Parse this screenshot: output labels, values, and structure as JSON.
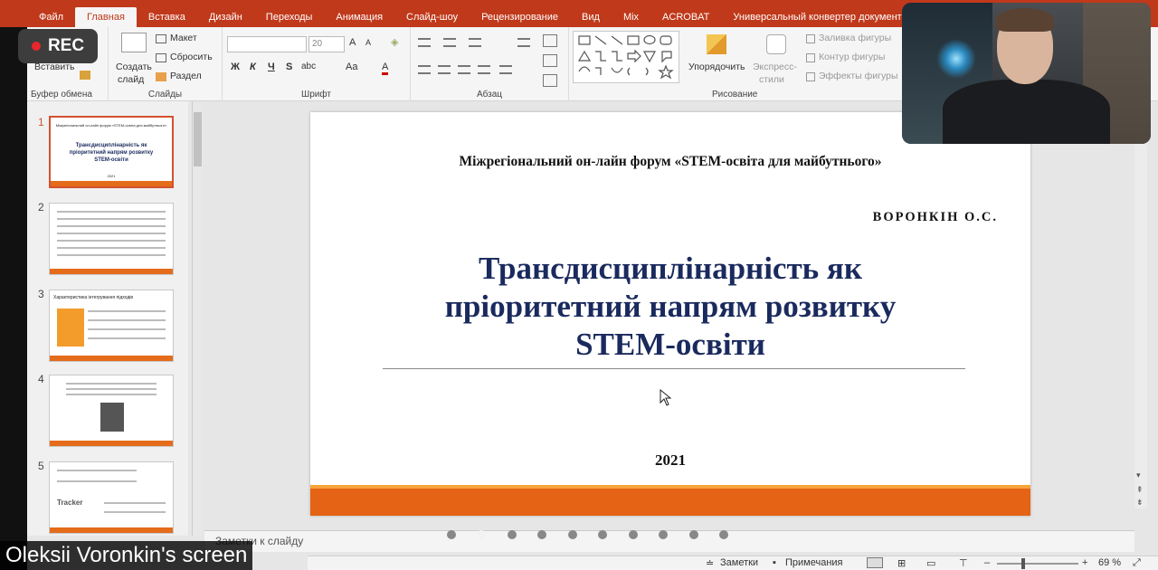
{
  "recording_badge": {
    "label": "REC"
  },
  "screen_share_label": "Oleksii Voronkin's screen",
  "ribbon_tabs": [
    {
      "label": "Файл",
      "active": false
    },
    {
      "label": "Главная",
      "active": true
    },
    {
      "label": "Вставка",
      "active": false
    },
    {
      "label": "Дизайн",
      "active": false
    },
    {
      "label": "Переходы",
      "active": false
    },
    {
      "label": "Анимация",
      "active": false
    },
    {
      "label": "Слайд-шоу",
      "active": false
    },
    {
      "label": "Рецензирование",
      "active": false
    },
    {
      "label": "Вид",
      "active": false
    },
    {
      "label": "Mix",
      "active": false
    },
    {
      "label": "ACROBAT",
      "active": false
    },
    {
      "label": "Универсальный конвертер документов",
      "active": false
    }
  ],
  "ribbon": {
    "clipboard": {
      "paste": "Вставить",
      "label": "Буфер обмена"
    },
    "slides": {
      "new_slide_line1": "Создать",
      "new_slide_line2": "слайд",
      "layout": "Макет",
      "reset": "Сбросить",
      "section": "Раздел",
      "label": "Слайды"
    },
    "font": {
      "font_size": "20",
      "bold": "Ж",
      "italic": "К",
      "underline": "Ч",
      "strike": "S",
      "spacing": "abc",
      "case": "Aa",
      "color": "A",
      "label": "Шрифт"
    },
    "paragraph": {
      "label": "Абзац"
    },
    "drawing": {
      "arrange": "Упорядочить",
      "quick_styles_line1": "Экспресс-",
      "quick_styles_line2": "стили",
      "shape_fill": "Заливка фигуры",
      "shape_outline": "Контур фигуры",
      "shape_effects": "Эффекты фигуры",
      "label": "Рисование"
    }
  },
  "thumbnails": [
    {
      "number": "1",
      "selected": true
    },
    {
      "number": "2",
      "selected": false
    },
    {
      "number": "3",
      "selected": false,
      "caption": "Характеристика інтегрування підходів"
    },
    {
      "number": "4",
      "selected": false
    },
    {
      "number": "5",
      "selected": false,
      "caption": "Tracker"
    }
  ],
  "slide": {
    "forum_line": "Міжрегіональний он-лайн форум «STEM-освіта для майбутнього»",
    "author": "ВОРОНКІН О.С.",
    "title_line1": "Трансдисциплінарність як",
    "title_line2": "пріоритетний  напрям розвитку",
    "title_line3": "STEM-освіти",
    "year": "2021"
  },
  "notes_placeholder": "Заметки к слайду",
  "pagination": {
    "count": 10,
    "active_index": 1
  },
  "statusbar": {
    "notes": "Заметки",
    "comments": "Примечания",
    "zoom": "69 %"
  },
  "colors": {
    "ribbon_tab_bar": "#c0391b",
    "slide_title": "#1a2a5e",
    "slide_band_light": "#f7a43a",
    "slide_band_dark": "#e46314",
    "rec_dot": "#e8262b"
  }
}
